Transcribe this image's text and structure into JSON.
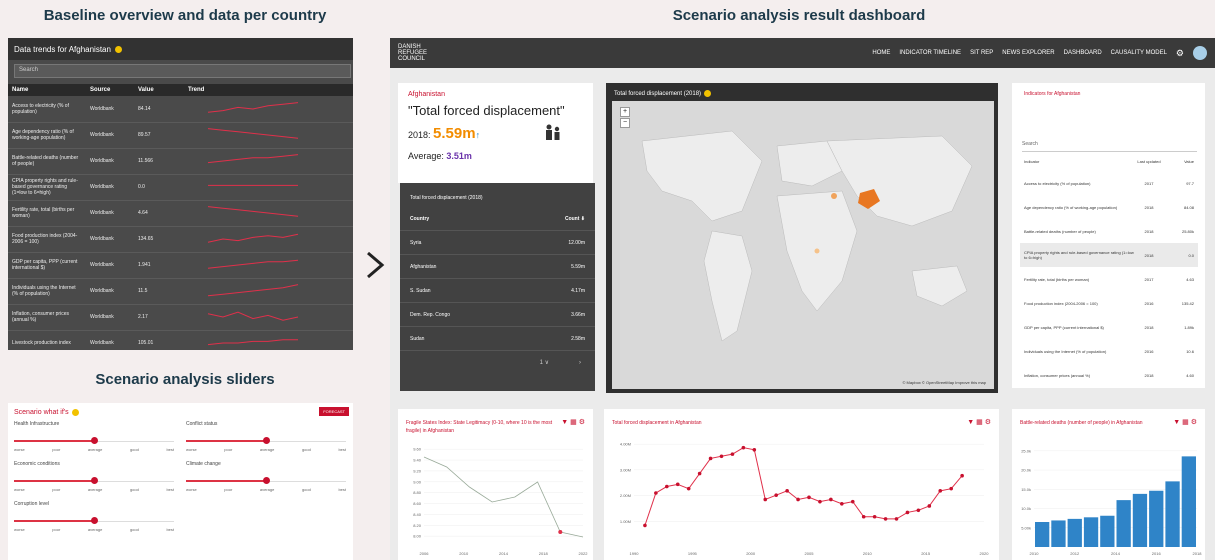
{
  "captions": {
    "left_top": "Baseline overview and data per country",
    "right": "Scenario analysis result dashboard",
    "left_bottom": "Scenario analysis sliders"
  },
  "baseline": {
    "title": "Data trends for Afghanistan",
    "search_placeholder": "Search",
    "columns": [
      "Name",
      "Source",
      "Value",
      "Trend"
    ],
    "rows": [
      {
        "name": "Access to electricity (% of population)",
        "source": "Worldbank",
        "value": "84.14",
        "trend": [
          3,
          4,
          6,
          5,
          7,
          8,
          9
        ]
      },
      {
        "name": "Age dependency ratio (% of working-age population)",
        "source": "Worldbank",
        "value": "89.57",
        "trend": [
          9,
          8,
          7,
          6,
          5,
          4,
          3
        ]
      },
      {
        "name": "Battle-related deaths (number of people)",
        "source": "Worldbank",
        "value": "11.566",
        "trend": [
          4,
          5,
          6,
          7,
          7,
          8,
          9
        ]
      },
      {
        "name": "CPIA property rights and rule-based governance rating (1=low to 6=high)",
        "source": "Worldbank",
        "value": "0.0",
        "trend": [
          6,
          6,
          6,
          6,
          6,
          6,
          6
        ]
      },
      {
        "name": "Fertility rate, total (births per woman)",
        "source": "Worldbank",
        "value": "4.64",
        "trend": [
          9,
          8,
          7,
          6,
          5,
          4,
          3
        ]
      },
      {
        "name": "Food production index (2004-2006 = 100)",
        "source": "Worldbank",
        "value": "134.65",
        "trend": [
          3,
          5,
          4,
          6,
          7,
          6,
          8
        ]
      },
      {
        "name": "GDP per capita, PPP (current international $)",
        "source": "Worldbank",
        "value": "1.941",
        "trend": [
          3,
          4,
          5,
          6,
          7,
          7,
          8
        ]
      },
      {
        "name": "Individuals using the Internet (% of population)",
        "source": "Worldbank",
        "value": "11.5",
        "trend": [
          2,
          3,
          4,
          5,
          6,
          7,
          9
        ]
      },
      {
        "name": "Inflation, consumer prices (annual %)",
        "source": "Worldbank",
        "value": "2.17",
        "trend": [
          7,
          5,
          8,
          4,
          6,
          3,
          5
        ]
      },
      {
        "name": "Livestock production index",
        "source": "Worldbank",
        "value": "105.01",
        "trend": [
          4,
          5,
          5,
          6,
          6,
          7,
          7
        ]
      }
    ]
  },
  "sliders": {
    "title": "Scenario what if's",
    "button": "FORECAST",
    "ticks": [
      "worse",
      "poor",
      "average",
      "good",
      "best"
    ],
    "items": [
      {
        "label": "Health Infrastructure",
        "level": 0.5
      },
      {
        "label": "Conflict status",
        "level": 0.5
      },
      {
        "label": "Economic conditions",
        "level": 0.5
      },
      {
        "label": "Climate change",
        "level": 0.5
      },
      {
        "label": "Corruption level",
        "level": 0.5
      }
    ]
  },
  "dashboard": {
    "logo": [
      "DANISH",
      "REFUGEE",
      "COUNCIL"
    ],
    "nav": [
      "HOME",
      "INDICATOR TIMELINE",
      "SIT REP",
      "NEWS EXPLORER",
      "DASHBOARD",
      "CAUSALITY MODEL"
    ],
    "country": "Afghanistan",
    "metric": "\"Total forced displacement\"",
    "year_label": "2018:",
    "year_value": "5.59m",
    "avg_label": "Average:",
    "avg_value": "3.51m",
    "table": {
      "title": "Total forced displacement (2018)",
      "col_country": "Country",
      "col_count": "Count",
      "rows": [
        {
          "country": "Syria",
          "count": "12.00m"
        },
        {
          "country": "Afghanistan",
          "count": "5.59m"
        },
        {
          "country": "S. Sudan",
          "count": "4.17m"
        },
        {
          "country": "Dem. Rep. Congo",
          "count": "3.66m"
        },
        {
          "country": "Sudan",
          "count": "2.58m"
        }
      ],
      "page": "1 ∨"
    },
    "map": {
      "title": "Total forced displacement (2018)",
      "attribution": "© Mapbox © OpenStreetMap Improve this map"
    },
    "indicators": {
      "title": "Indicators for Afghanistan",
      "search": "Search",
      "col_indicator": "Indicator",
      "col_updated": "Last updated",
      "col_value": "Value",
      "rows": [
        {
          "name": "Access to electricity (% of population)",
          "updated": "2017",
          "value": "97.7"
        },
        {
          "name": "Age dependency ratio (% of working-age population)",
          "updated": "2018",
          "value": "84.08"
        },
        {
          "name": "Battle-related deaths (number of people)",
          "updated": "2018",
          "value": "25.80k"
        },
        {
          "name": "CPIA property rights and rule-based governance rating (1=low to 6=high)",
          "updated": "2018",
          "value": "0.0"
        },
        {
          "name": "Fertility rate, total (births per woman)",
          "updated": "2017",
          "value": "4.63"
        },
        {
          "name": "Food production index (2004-2006 = 100)",
          "updated": "2016",
          "value": "135.42"
        },
        {
          "name": "GDP per capita, PPP (current international $)",
          "updated": "2018",
          "value": "1.89k"
        },
        {
          "name": "Individuals using the Internet (% of population)",
          "updated": "2016",
          "value": "10.6"
        },
        {
          "name": "Inflation, consumer prices (annual %)",
          "updated": "2018",
          "value": "4.60"
        }
      ]
    },
    "chart_titles": {
      "fsi": "Fragile States Index: State Legitimacy (0-10, where 10 is the most fragile) in Afghanistan",
      "tfd": "Total forced displacement in Afghanistan",
      "brd": "Battle-related deaths (number of people) in Afghanistan"
    },
    "chart_icons": "▼ ▦ ⚙"
  },
  "chart_data": [
    {
      "type": "line",
      "title": "Fragile States Index: State Legitimacy (0-10, where 10 is the most fragile) in Afghanistan",
      "x": [
        2006,
        2008,
        2010,
        2012,
        2014,
        2016,
        2018,
        2020
      ],
      "y": [
        9.8,
        9.6,
        9.2,
        8.9,
        9.0,
        9.3,
        8.3,
        8.2
      ],
      "ylim": [
        8.0,
        10.0
      ],
      "xticks": [
        "2006",
        "2010",
        "2014",
        "2018",
        "2022"
      ],
      "yticks": [
        "8.00",
        "8.20",
        "8.40",
        "8.60",
        "8.80",
        "9.00",
        "9.20",
        "9.40",
        "9.60"
      ]
    },
    {
      "type": "line",
      "title": "Total forced displacement in Afghanistan",
      "x": [
        1989,
        1990,
        1991,
        1992,
        1993,
        1994,
        1995,
        1996,
        1997,
        1998,
        1999,
        2000,
        2001,
        2002,
        2003,
        2004,
        2005,
        2006,
        2007,
        2008,
        2009,
        2010,
        2011,
        2012,
        2013,
        2014,
        2015,
        2016,
        2017,
        2018
      ],
      "y": [
        1.0,
        2.5,
        2.8,
        2.9,
        2.7,
        3.4,
        4.1,
        4.2,
        4.3,
        4.6,
        4.5,
        2.2,
        2.4,
        2.6,
        2.2,
        2.3,
        2.1,
        2.2,
        2.0,
        2.1,
        1.4,
        1.4,
        1.3,
        1.3,
        1.6,
        1.7,
        1.9,
        2.6,
        2.7,
        3.3
      ],
      "ylim": [
        0,
        5
      ],
      "xticks": [
        "1990",
        "1995",
        "2000",
        "2005",
        "2010",
        "2015",
        "2020"
      ],
      "yticks": [
        "1.00M",
        "2.00M",
        "3.00M",
        "4.00M"
      ]
    },
    {
      "type": "bar",
      "title": "Battle-related deaths (number of people) in Afghanistan",
      "categories": [
        "2009",
        "2010",
        "2011",
        "2012",
        "2013",
        "2014",
        "2015",
        "2016",
        "2017",
        "2018"
      ],
      "values": [
        8.0,
        8.5,
        9.0,
        9.5,
        10.0,
        15.0,
        17.0,
        18.0,
        21.0,
        29.0
      ],
      "ylim": [
        0,
        32
      ],
      "xticks": [
        "2010",
        "2012",
        "2014",
        "2016",
        "2018"
      ],
      "yticks": [
        "5.00k",
        "10.0k",
        "15.0k",
        "20.0k",
        "25.0k"
      ]
    }
  ]
}
